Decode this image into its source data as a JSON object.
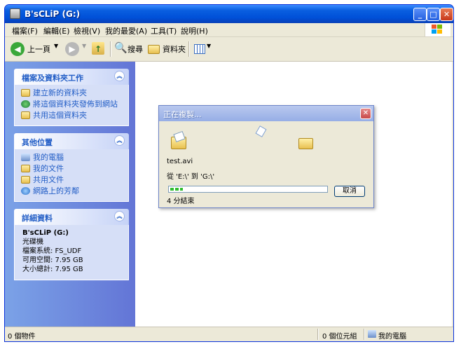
{
  "window": {
    "title": "B'sCLiP (G:)"
  },
  "titlebar_buttons": {
    "minimize": "_",
    "maximize": "□",
    "close": "✕"
  },
  "menu": [
    "檔案(F)",
    "編輯(E)",
    "檢視(V)",
    "我的最愛(A)",
    "工具(T)",
    "說明(H)"
  ],
  "toolbar": {
    "back": "上一頁",
    "search": "搜尋",
    "folders": "資料夾"
  },
  "tasks_panel": {
    "title": "檔案及資料夾工作",
    "items": [
      "建立新的資料夾",
      "將這個資料夾發佈到網站",
      "共用這個資料夾"
    ]
  },
  "places_panel": {
    "title": "其他位置",
    "items": [
      "我的電腦",
      "我的文件",
      "共用文件",
      "網路上的芳鄰"
    ]
  },
  "details_panel": {
    "title": "詳細資料",
    "name": "B'sCLiP (G:)",
    "type": "光碟機",
    "filesystem": "檔案系統: FS_UDF",
    "free": "可用空間: 7.95 GB",
    "total": "大小總計: 7.95 GB"
  },
  "status": {
    "objects": "0 個物件",
    "size": "0 個位元組",
    "location": "我的電腦"
  },
  "dialog": {
    "title": "正在複製...",
    "filename": "test.avi",
    "route": "從 'E:\\' 到 'G:\\'",
    "remaining": "4 分結束",
    "cancel": "取消",
    "progress": 0.08
  },
  "colors": {
    "title_blue": "#0a5fe0",
    "link_blue": "#215dc6",
    "progress_green": "#2fbd2f"
  }
}
